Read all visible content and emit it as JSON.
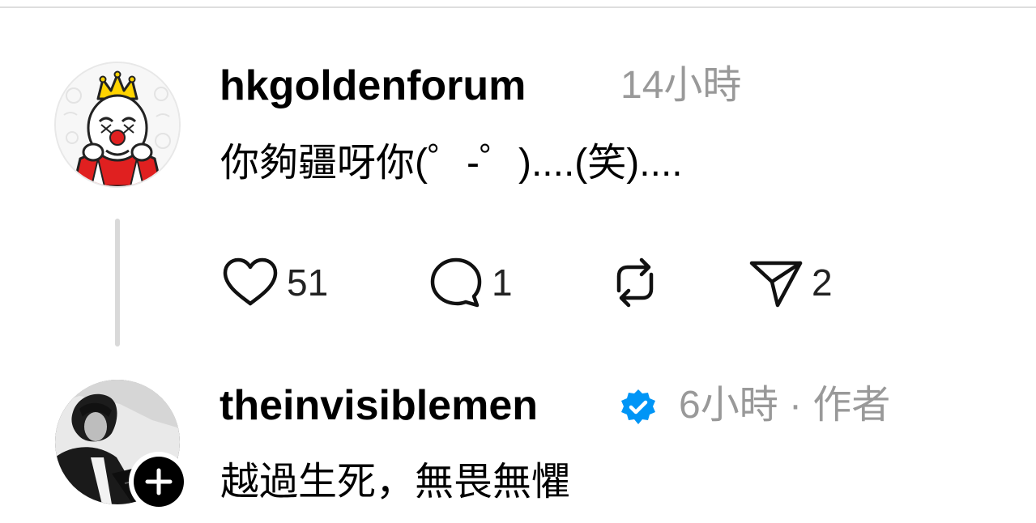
{
  "comments": [
    {
      "username": "hkgoldenforum",
      "time": "14小時",
      "avatar_icon": "clown-king-avatar",
      "text": "你夠疆呀你(゜-゜)....(笑)....",
      "actions": {
        "likes": "51",
        "replies": "1",
        "shares": "2"
      }
    },
    {
      "username": "theinvisiblemen",
      "verified": true,
      "verified_color": "#0095f6",
      "time": "6小時",
      "separator": "·",
      "author_label": "作者",
      "avatar_icon": "portrait-avatar",
      "text": "越過生死，無畏無懼"
    }
  ],
  "icons": {
    "like": "heart-icon",
    "reply": "speech-bubble-icon",
    "repost": "repost-icon",
    "share": "paper-plane-icon",
    "follow": "plus-icon"
  }
}
